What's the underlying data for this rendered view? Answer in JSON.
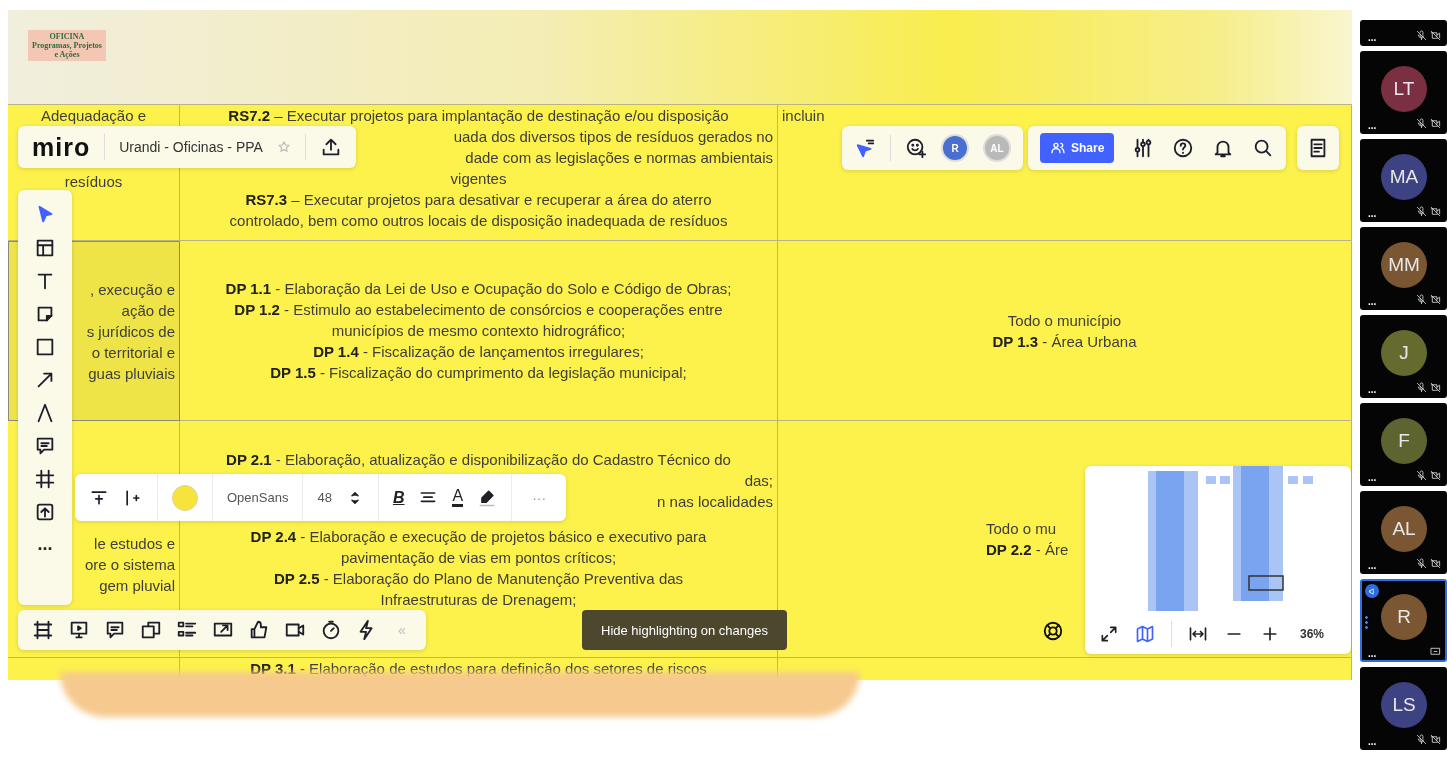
{
  "banner": {
    "logo_lines": [
      "OFICINA",
      "Programas, Projetos",
      "e Ações"
    ]
  },
  "board": {
    "app_name": "miro",
    "board_title": "Urandi - Oficinas - PPA",
    "table_rows": [
      {
        "cells": [
          {
            "lines": [
              {
                "kind": "line",
                "text": "Adequadação e"
              },
              {
                "kind": "line",
                "text": "resíduos"
              }
            ]
          },
          {
            "lines": [
              {
                "kind": "line",
                "text": "**RS7.2** – Executar projetos para implantação de destinação e/ou disposição"
              },
              {
                "kind": "cut_left",
                "text": "uada dos diversos tipos de resíduos gerados no"
              },
              {
                "kind": "cut_left",
                "text": "dade com as legislações e normas ambientais"
              },
              {
                "kind": "line",
                "text": "vigentes"
              },
              {
                "kind": "line",
                "text": "**RS7.3** – Executar projetos para desativar e recuperar a área do aterro"
              },
              {
                "kind": "line",
                "text": "controlado, bem como outros locais de disposição inadequada de resíduos"
              }
            ]
          },
          {
            "lines": [
              {
                "kind": "cut_right",
                "text": "incluin"
              }
            ]
          }
        ]
      },
      {
        "cells": [
          {
            "lines": [
              {
                "kind": "cut_left",
                "text": ", execução e"
              },
              {
                "kind": "cut_left",
                "text": "ação de"
              },
              {
                "kind": "cut_left",
                "text": "s jurídicos de"
              },
              {
                "kind": "cut_left",
                "text": "o territorial e"
              },
              {
                "kind": "cut_left",
                "text": "guas pluviais"
              }
            ]
          },
          {
            "lines": [
              {
                "kind": "line",
                "text": "**DP 1.1** - Elaboração da Lei de Uso e Ocupação do Solo e Código de Obras;"
              },
              {
                "kind": "line",
                "text": "**DP 1.2** - Estimulo ao estabelecimento de consórcios e cooperações entre"
              },
              {
                "kind": "line",
                "text": "municípios de mesmo contexto hidrográfico;"
              },
              {
                "kind": "line",
                "text": "**DP 1.4** - Fiscalização de lançamentos irregulares;"
              },
              {
                "kind": "line",
                "text": "**DP 1.5** - Fiscalização do cumprimento da legislação municipal;"
              }
            ]
          },
          {
            "lines": [
              {
                "kind": "line",
                "text": "Todo o município"
              },
              {
                "kind": "line",
                "text": "**DP 1.3** - Área Urbana"
              }
            ]
          }
        ]
      },
      {
        "cells": [
          {
            "lines": [
              {
                "kind": "cut_left",
                "text": "le estudos e"
              },
              {
                "kind": "cut_left",
                "text": "ore o sistema"
              },
              {
                "kind": "cut_left",
                "text": "gem pluvial"
              }
            ]
          },
          {
            "lines": [
              {
                "kind": "line",
                "text": "**DP 2.1** - Elaboração, atualização e disponibilização do Cadastro Técnico do"
              },
              {
                "kind": "cut_left",
                "text": "das;"
              },
              {
                "kind": "cut_left",
                "text": "n nas localidades"
              },
              {
                "kind": "line",
                "text": "**DP 2.4** - Elaboração e execução de projetos básico e executivo para"
              },
              {
                "kind": "line",
                "text": "pavimentação de vias em pontos críticos;"
              },
              {
                "kind": "line",
                "text": "**DP 2.5** - Elaboração do Plano de Manutenção Preventiva das"
              },
              {
                "kind": "line",
                "text": "Infraestruturas de Drenagem;"
              }
            ]
          },
          {
            "lines": [
              {
                "kind": "cut_right",
                "text": "Todo o mu"
              },
              {
                "kind": "cut_right",
                "text": "**DP 2.2** - Áre"
              }
            ]
          }
        ]
      },
      {
        "cells": [
          {},
          {
            "lines": [
              {
                "kind": "line",
                "text": "**DP 3.1** - Elaboração de estudos para definição dos setores de riscos"
              }
            ]
          },
          {}
        ]
      }
    ],
    "left_toolbar": {
      "more": "..."
    },
    "format_toolbar": {
      "font": "OpenSans",
      "font_size": "48",
      "bold": "B",
      "text_color": "A",
      "more": "···"
    },
    "bottom_toolbar": {
      "collapse": "«"
    },
    "tooltip": "Hide highlighting on changes",
    "collaborators": [
      {
        "initials": "R",
        "color": "#4a6fd1"
      },
      {
        "initials": "AL",
        "color": "#b9b9b9"
      }
    ],
    "share": "Share",
    "zoom": "36%"
  },
  "participants": {
    "partial_tile": {
      "dots": "..."
    },
    "tiles": [
      {
        "initials": "LT",
        "color": "#7a2f42",
        "dots": "...",
        "muted": true,
        "active": false
      },
      {
        "initials": "MA",
        "color": "#3d4283",
        "dots": "...",
        "muted": true,
        "active": false
      },
      {
        "initials": "MM",
        "color": "#7a5633",
        "dots": "...",
        "muted": true,
        "active": false
      },
      {
        "initials": "J",
        "color": "#656a2e",
        "dots": "...",
        "muted": true,
        "active": false
      },
      {
        "initials": "F",
        "color": "#5d6430",
        "dots": "...",
        "muted": true,
        "active": false
      },
      {
        "initials": "AL",
        "color": "#7a5633",
        "dots": "...",
        "muted": true,
        "active": false
      },
      {
        "initials": "R",
        "color": "#7a5633",
        "dots": "...",
        "muted": false,
        "active": true
      },
      {
        "initials": "LS",
        "color": "#3d4283",
        "dots": "...",
        "muted": true,
        "active": false
      }
    ]
  }
}
